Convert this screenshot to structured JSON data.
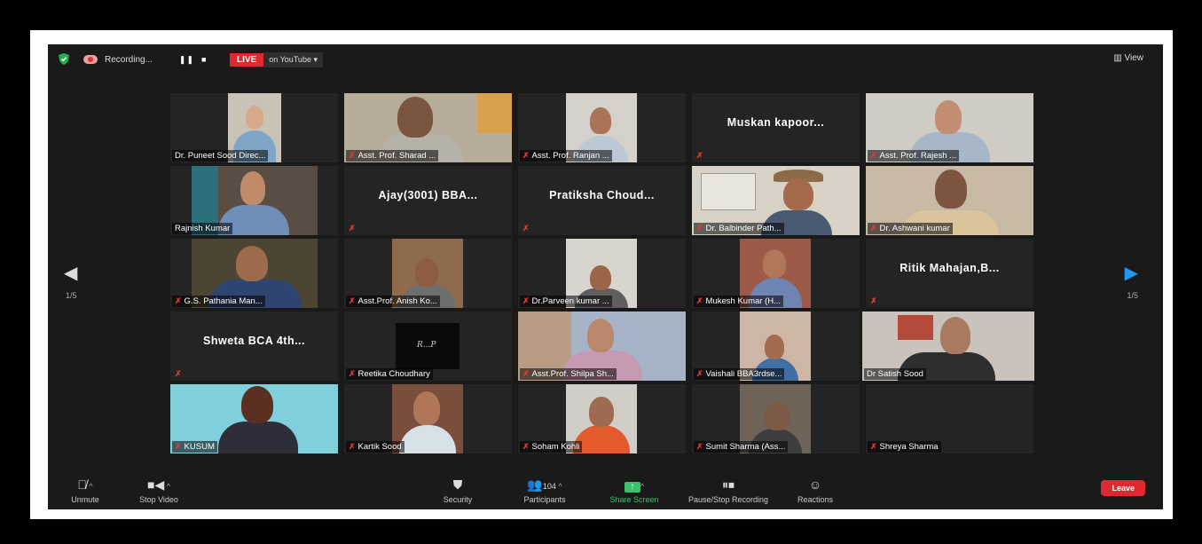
{
  "topbar": {
    "recording_label": "Recording...",
    "pause_glyph": "❚❚",
    "stop_glyph": "■",
    "live_label": "LIVE",
    "stream_target": "on YouTube ▾",
    "view_label": "View"
  },
  "gallery": {
    "page": "1/5",
    "tiles": [
      {
        "name": "Dr. Puneet Sood Direc...",
        "muted": false
      },
      {
        "name": "Asst. Prof. Sharad ...",
        "muted": true
      },
      {
        "name": "Asst. Prof. Ranjan ...",
        "muted": true
      },
      {
        "name": "",
        "display_name": "Muskan  kapoor...",
        "muted": true
      },
      {
        "name": "Asst. Prof. Rajesh ...",
        "muted": true
      },
      {
        "name": "Rajnish Kumar",
        "muted": false
      },
      {
        "name": "",
        "display_name": "Ajay(3001) BBA...",
        "muted": true
      },
      {
        "name": "",
        "display_name": "Pratiksha  Choud...",
        "muted": true
      },
      {
        "name": "Dr. Balbinder Path...",
        "muted": true
      },
      {
        "name": "Dr. Ashwani kumar",
        "muted": true
      },
      {
        "name": "G.S. Pathania Man...",
        "muted": true
      },
      {
        "name": "Asst.Prof. Anish Ko...",
        "muted": true
      },
      {
        "name": "Dr.Parveen kumar ...",
        "muted": true
      },
      {
        "name": "Mukesh Kumar (H...",
        "muted": true
      },
      {
        "name": "",
        "display_name": "Ritik  Mahajan,B...",
        "muted": true
      },
      {
        "name": "",
        "display_name": "Shweta BCA 4th...",
        "muted": true
      },
      {
        "name": "Reetika Choudhary",
        "muted": true
      },
      {
        "name": "Asst.Prof. Shilpa Sh...",
        "muted": true
      },
      {
        "name": "Vaishali BBA3rdse...",
        "muted": true
      },
      {
        "name": "Dr Satish Sood",
        "muted": false
      },
      {
        "name": "KUSUM",
        "muted": true
      },
      {
        "name": "Kartik Sood",
        "muted": true
      },
      {
        "name": "Soham Kohli",
        "muted": true
      },
      {
        "name": "Sumit Sharma (Ass...",
        "muted": true
      },
      {
        "name": "Shreya Sharma",
        "muted": true
      }
    ]
  },
  "toolbar": {
    "unmute": "Unmute",
    "stop_video": "Stop Video",
    "security": "Security",
    "participants": "Participants",
    "participants_count": "104",
    "share_screen": "Share Screen",
    "pause_stop_recording": "Pause/Stop Recording",
    "reactions": "Reactions",
    "leave": "Leave"
  },
  "colors": {
    "live_red": "#e0282e",
    "share_green": "#39c16c",
    "active_speaker_outline": "#d5e63a",
    "muted_icon_red": "#e53935"
  },
  "icons": {
    "shield": "shield-icon",
    "recording": "recording-cloud-icon",
    "view": "gallery-view-icon",
    "mic_off": "mic-off-icon",
    "video": "camera-icon",
    "security": "shield-icon",
    "participants": "people-icon",
    "share": "share-screen-icon",
    "recording_controls": "pause-stop-icon",
    "reactions": "emoji-icon"
  }
}
